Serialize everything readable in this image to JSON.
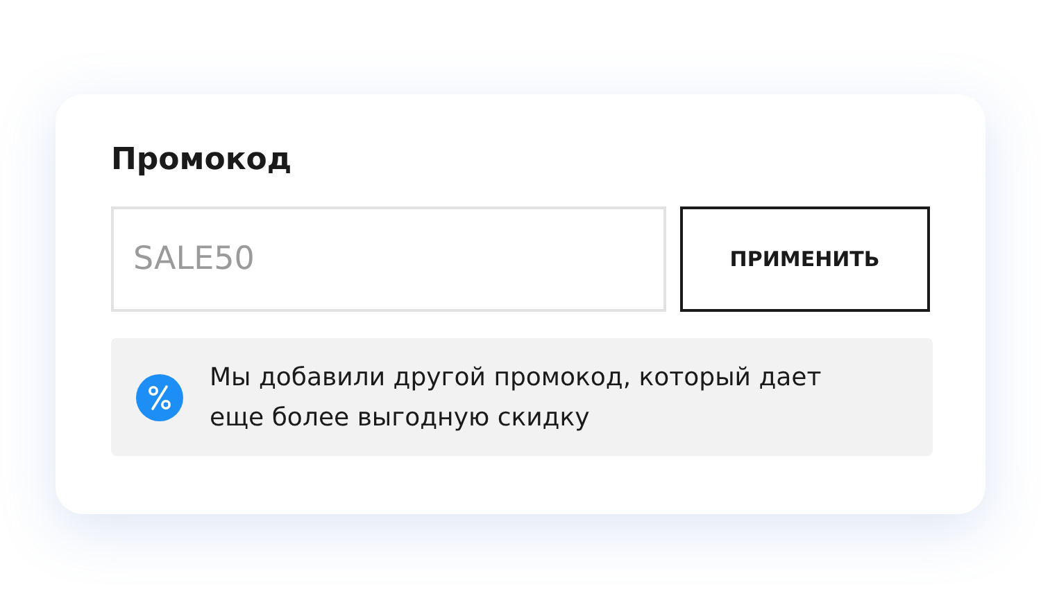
{
  "promo": {
    "title": "Промокод",
    "input": {
      "placeholder": "SALE50"
    },
    "apply_button": "ПРИМЕНИТЬ",
    "notice": "Мы добавили другой промокод, который дает еще более выгодную скидку"
  }
}
